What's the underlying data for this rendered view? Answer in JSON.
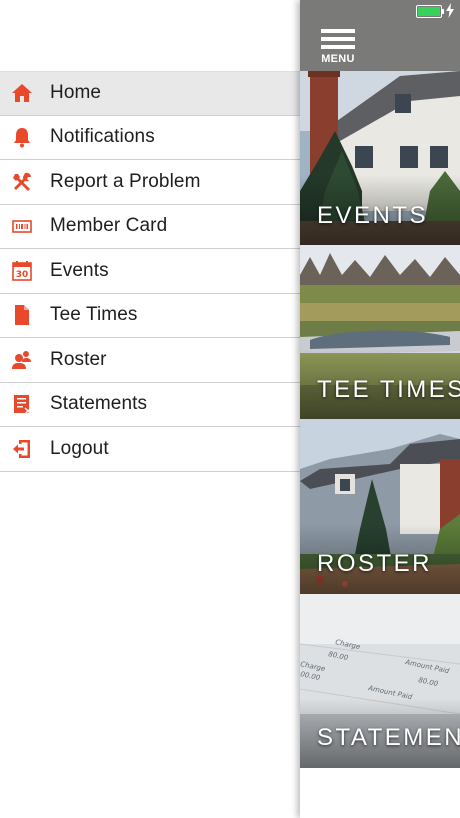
{
  "menu": {
    "items": [
      {
        "label": "Home",
        "icon": "home-icon",
        "active": true
      },
      {
        "label": "Notifications",
        "icon": "bell-icon"
      },
      {
        "label": "Report a Problem",
        "icon": "tools-icon"
      },
      {
        "label": "Member Card",
        "icon": "barcode-card-icon"
      },
      {
        "label": "Events",
        "icon": "calendar-icon"
      },
      {
        "label": "Tee Times",
        "icon": "document-icon"
      },
      {
        "label": "Roster",
        "icon": "people-icon"
      },
      {
        "label": "Statements",
        "icon": "statement-icon"
      },
      {
        "label": "Logout",
        "icon": "logout-icon"
      }
    ]
  },
  "header": {
    "menu_label": "MENU"
  },
  "tiles": [
    {
      "label": "EVENTS"
    },
    {
      "label": "TEE TIMES"
    },
    {
      "label": "ROSTER"
    },
    {
      "label": "STATEMENTS"
    }
  ],
  "statement_image_text": {
    "charge_1": "Charge",
    "amount_1": "Amount Paid",
    "value_1": "80.00",
    "value_2": "80.00",
    "charge_2": "Charge",
    "amount_2": "Amount Paid",
    "value_3": "00.00"
  },
  "colors": {
    "accent": "#e8492a",
    "topbar": "#7a7a78",
    "active_row": "#e8e8e8",
    "battery": "#35d35a"
  }
}
